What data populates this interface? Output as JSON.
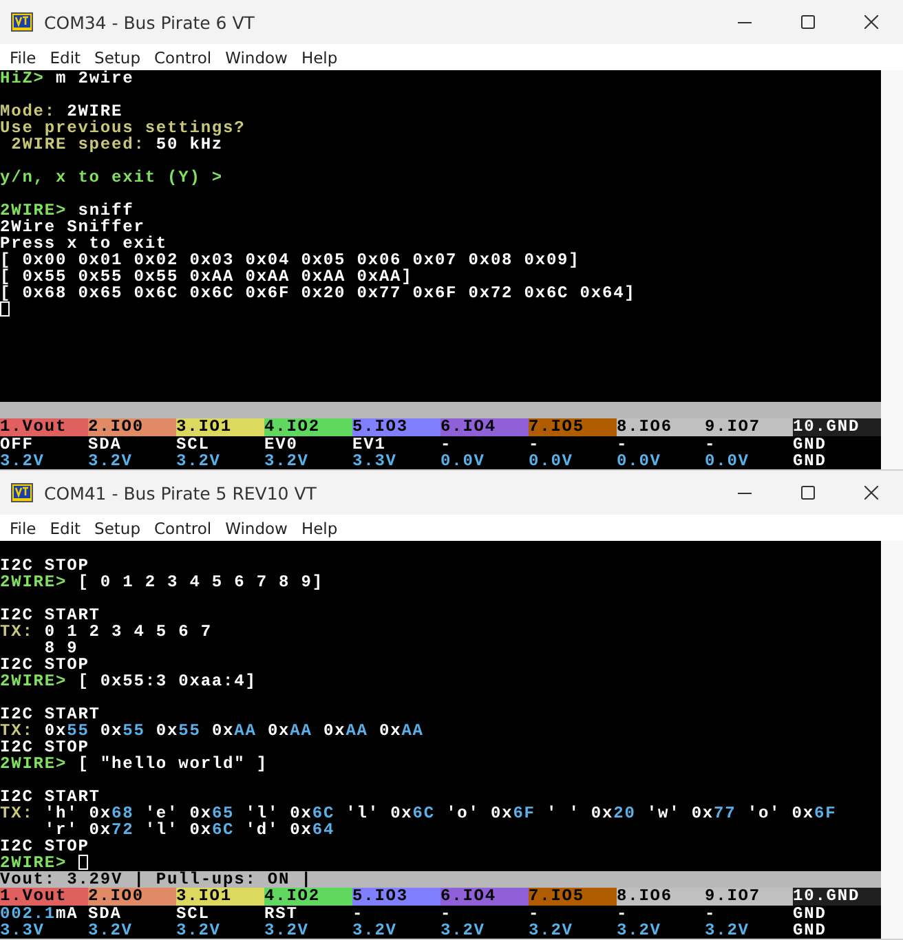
{
  "windows": [
    {
      "title": "COM34 - Bus Pirate 6 VT",
      "menu": [
        "File",
        "Edit",
        "Setup",
        "Control",
        "Window",
        "Help"
      ],
      "lines": [
        {
          "segments": [
            {
              "kind": "prompt",
              "text": "HiZ> "
            },
            {
              "kind": "text",
              "text": "m 2wire"
            }
          ]
        },
        {
          "kind": "blank"
        },
        {
          "segments": [
            {
              "kind": "label",
              "text": "Mode: "
            },
            {
              "kind": "text",
              "text": "2WIRE"
            }
          ]
        },
        {
          "segments": [
            {
              "kind": "label",
              "text": "Use previous settings?"
            }
          ]
        },
        {
          "segments": [
            {
              "kind": "label",
              "text": " 2WIRE speed: "
            },
            {
              "kind": "text",
              "text": "50 kHz"
            }
          ]
        },
        {
          "kind": "blank"
        },
        {
          "segments": [
            {
              "kind": "prompt",
              "text": "y/n, x to exit (Y) >"
            }
          ]
        },
        {
          "kind": "blank"
        },
        {
          "segments": [
            {
              "kind": "prompt",
              "text": "2WIRE> "
            },
            {
              "kind": "text",
              "text": "sniff"
            }
          ]
        },
        {
          "segments": [
            {
              "kind": "text",
              "text": "2Wire Sniffer"
            }
          ]
        },
        {
          "segments": [
            {
              "kind": "text",
              "text": "Press x to exit"
            }
          ]
        },
        {
          "segments": [
            {
              "kind": "text",
              "text": "[ 0x00 0x01 0x02 0x03 0x04 0x05 0x06 0x07 0x08 0x09]"
            }
          ]
        },
        {
          "segments": [
            {
              "kind": "text",
              "text": "[ 0x55 0x55 0x55 0xAA 0xAA 0xAA 0xAA]"
            }
          ]
        },
        {
          "segments": [
            {
              "kind": "text",
              "text": "[ 0x68 0x65 0x6C 0x6C 0x6F 0x20 0x77 0x6F 0x72 0x6C 0x64]"
            }
          ]
        },
        {
          "segments": [
            {
              "kind": "cursor"
            }
          ]
        }
      ],
      "pins": [
        {
          "label": "1.Vout",
          "color": "#e06060"
        },
        {
          "label": "2.IO0",
          "color": "#e08a66"
        },
        {
          "label": "3.IO1",
          "color": "#dcd860"
        },
        {
          "label": "4.IO2",
          "color": "#60d860"
        },
        {
          "label": "5.IO3",
          "color": "#8080ff"
        },
        {
          "label": "6.IO4",
          "color": "#9060d8"
        },
        {
          "label": "7.IO5",
          "color": "#b05c00"
        },
        {
          "label": "8.IO6",
          "color": "#c0c0c0"
        },
        {
          "label": "9.IO7",
          "color": "#c0c0c0"
        },
        {
          "label": "10.GND",
          "color": "#202020"
        }
      ],
      "pin_rows": [
        [
          [
            {
              "kind": "text",
              "text": "OFF"
            }
          ],
          [
            {
              "kind": "text",
              "text": "SDA"
            }
          ],
          [
            {
              "kind": "text",
              "text": "SCL"
            }
          ],
          [
            {
              "kind": "text",
              "text": "EV0"
            }
          ],
          [
            {
              "kind": "text",
              "text": "EV1"
            }
          ],
          [
            {
              "kind": "text",
              "text": "-"
            }
          ],
          [
            {
              "kind": "text",
              "text": "-"
            }
          ],
          [
            {
              "kind": "text",
              "text": "-"
            }
          ],
          [
            {
              "kind": "text",
              "text": "-"
            }
          ],
          [
            {
              "kind": "text",
              "text": "GND"
            }
          ]
        ],
        [
          [
            {
              "kind": "value",
              "text": "3.2V"
            }
          ],
          [
            {
              "kind": "value",
              "text": "3.2V"
            }
          ],
          [
            {
              "kind": "value",
              "text": "3.2V"
            }
          ],
          [
            {
              "kind": "value",
              "text": "3.2V"
            }
          ],
          [
            {
              "kind": "value",
              "text": "3.3V"
            }
          ],
          [
            {
              "kind": "value",
              "text": "0.0V"
            }
          ],
          [
            {
              "kind": "value",
              "text": "0.0V"
            }
          ],
          [
            {
              "kind": "value",
              "text": "0.0V"
            }
          ],
          [
            {
              "kind": "value",
              "text": "0.0V"
            }
          ],
          [
            {
              "kind": "text",
              "text": "GND"
            }
          ]
        ]
      ]
    },
    {
      "title": "COM41 - Bus Pirate 5 REV10 VT",
      "menu": [
        "File",
        "Edit",
        "Setup",
        "Control",
        "Window",
        "Help"
      ],
      "lines": [
        {
          "kind": "blank"
        },
        {
          "segments": [
            {
              "kind": "text",
              "text": "I2C STOP"
            }
          ]
        },
        {
          "segments": [
            {
              "kind": "prompt",
              "text": "2WIRE> "
            },
            {
              "kind": "text",
              "text": "[ 0 1 2 3 4 5 6 7 8 9]"
            }
          ]
        },
        {
          "kind": "blank"
        },
        {
          "segments": [
            {
              "kind": "text",
              "text": "I2C START"
            }
          ]
        },
        {
          "segments": [
            {
              "kind": "label",
              "text": "TX: "
            },
            {
              "kind": "text",
              "text": "0 1 2 3 4 5 6 7"
            }
          ]
        },
        {
          "segments": [
            {
              "kind": "text",
              "text": "    8 9"
            }
          ]
        },
        {
          "segments": [
            {
              "kind": "text",
              "text": "I2C STOP"
            }
          ]
        },
        {
          "segments": [
            {
              "kind": "prompt",
              "text": "2WIRE> "
            },
            {
              "kind": "text",
              "text": "[ 0x55:3 0xaa:4]"
            }
          ]
        },
        {
          "kind": "blank"
        },
        {
          "segments": [
            {
              "kind": "text",
              "text": "I2C START"
            }
          ]
        },
        {
          "segments": [
            {
              "kind": "label",
              "text": "TX: "
            },
            {
              "kind": "text",
              "text": "0x"
            },
            {
              "kind": "value",
              "text": "55"
            },
            {
              "kind": "text",
              "text": " 0x"
            },
            {
              "kind": "value",
              "text": "55"
            },
            {
              "kind": "text",
              "text": " 0x"
            },
            {
              "kind": "value",
              "text": "55"
            },
            {
              "kind": "text",
              "text": " 0x"
            },
            {
              "kind": "value",
              "text": "AA"
            },
            {
              "kind": "text",
              "text": " 0x"
            },
            {
              "kind": "value",
              "text": "AA"
            },
            {
              "kind": "text",
              "text": " 0x"
            },
            {
              "kind": "value",
              "text": "AA"
            },
            {
              "kind": "text",
              "text": " 0x"
            },
            {
              "kind": "value",
              "text": "AA"
            }
          ]
        },
        {
          "segments": [
            {
              "kind": "text",
              "text": "I2C STOP"
            }
          ]
        },
        {
          "segments": [
            {
              "kind": "prompt",
              "text": "2WIRE> "
            },
            {
              "kind": "text",
              "text": "[ \"hello world\" ]"
            }
          ]
        },
        {
          "kind": "blank"
        },
        {
          "segments": [
            {
              "kind": "text",
              "text": "I2C START"
            }
          ]
        },
        {
          "segments": [
            {
              "kind": "label",
              "text": "TX: "
            },
            {
              "kind": "text",
              "text": "'h' 0x"
            },
            {
              "kind": "value",
              "text": "68"
            },
            {
              "kind": "text",
              "text": " 'e' 0x"
            },
            {
              "kind": "value",
              "text": "65"
            },
            {
              "kind": "text",
              "text": " 'l' 0x"
            },
            {
              "kind": "value",
              "text": "6C"
            },
            {
              "kind": "text",
              "text": " 'l' 0x"
            },
            {
              "kind": "value",
              "text": "6C"
            },
            {
              "kind": "text",
              "text": " 'o' 0x"
            },
            {
              "kind": "value",
              "text": "6F"
            },
            {
              "kind": "text",
              "text": " ' ' 0x"
            },
            {
              "kind": "value",
              "text": "20"
            },
            {
              "kind": "text",
              "text": " 'w' 0x"
            },
            {
              "kind": "value",
              "text": "77"
            },
            {
              "kind": "text",
              "text": " 'o' 0x"
            },
            {
              "kind": "value",
              "text": "6F"
            }
          ]
        },
        {
          "segments": [
            {
              "kind": "text",
              "text": "    'r' 0x"
            },
            {
              "kind": "value",
              "text": "72"
            },
            {
              "kind": "text",
              "text": " 'l' 0x"
            },
            {
              "kind": "value",
              "text": "6C"
            },
            {
              "kind": "text",
              "text": " 'd' 0x"
            },
            {
              "kind": "value",
              "text": "64"
            }
          ]
        },
        {
          "segments": [
            {
              "kind": "text",
              "text": "I2C STOP"
            }
          ]
        },
        {
          "segments": [
            {
              "kind": "prompt",
              "text": "2WIRE> "
            },
            {
              "kind": "cursor"
            }
          ]
        }
      ],
      "status_bar": "Vout: 3.29V | Pull-ups: ON |",
      "pins": [
        {
          "label": "1.Vout",
          "color": "#e06060"
        },
        {
          "label": "2.IO0",
          "color": "#e08a66"
        },
        {
          "label": "3.IO1",
          "color": "#dcd860"
        },
        {
          "label": "4.IO2",
          "color": "#60d860"
        },
        {
          "label": "5.IO3",
          "color": "#8080ff"
        },
        {
          "label": "6.IO4",
          "color": "#9060d8"
        },
        {
          "label": "7.IO5",
          "color": "#b05c00"
        },
        {
          "label": "8.IO6",
          "color": "#c0c0c0"
        },
        {
          "label": "9.IO7",
          "color": "#c0c0c0"
        },
        {
          "label": "10.GND",
          "color": "#202020"
        }
      ],
      "pin_rows": [
        [
          [
            {
              "kind": "value",
              "text": "002.1"
            },
            {
              "kind": "text",
              "text": "mA"
            }
          ],
          [
            {
              "kind": "text",
              "text": "SDA"
            }
          ],
          [
            {
              "kind": "text",
              "text": "SCL"
            }
          ],
          [
            {
              "kind": "text",
              "text": "RST"
            }
          ],
          [
            {
              "kind": "text",
              "text": "-"
            }
          ],
          [
            {
              "kind": "text",
              "text": "-"
            }
          ],
          [
            {
              "kind": "text",
              "text": "-"
            }
          ],
          [
            {
              "kind": "text",
              "text": "-"
            }
          ],
          [
            {
              "kind": "text",
              "text": "-"
            }
          ],
          [
            {
              "kind": "text",
              "text": "GND"
            }
          ]
        ],
        [
          [
            {
              "kind": "value",
              "text": "3.3V"
            }
          ],
          [
            {
              "kind": "value",
              "text": "3.2V"
            }
          ],
          [
            {
              "kind": "value",
              "text": "3.2V"
            }
          ],
          [
            {
              "kind": "value",
              "text": "3.2V"
            }
          ],
          [
            {
              "kind": "value",
              "text": "3.2V"
            }
          ],
          [
            {
              "kind": "value",
              "text": "3.2V"
            }
          ],
          [
            {
              "kind": "value",
              "text": "3.2V"
            }
          ],
          [
            {
              "kind": "value",
              "text": "3.2V"
            }
          ],
          [
            {
              "kind": "value",
              "text": "3.2V"
            }
          ],
          [
            {
              "kind": "text",
              "text": "GND"
            }
          ]
        ]
      ]
    }
  ]
}
